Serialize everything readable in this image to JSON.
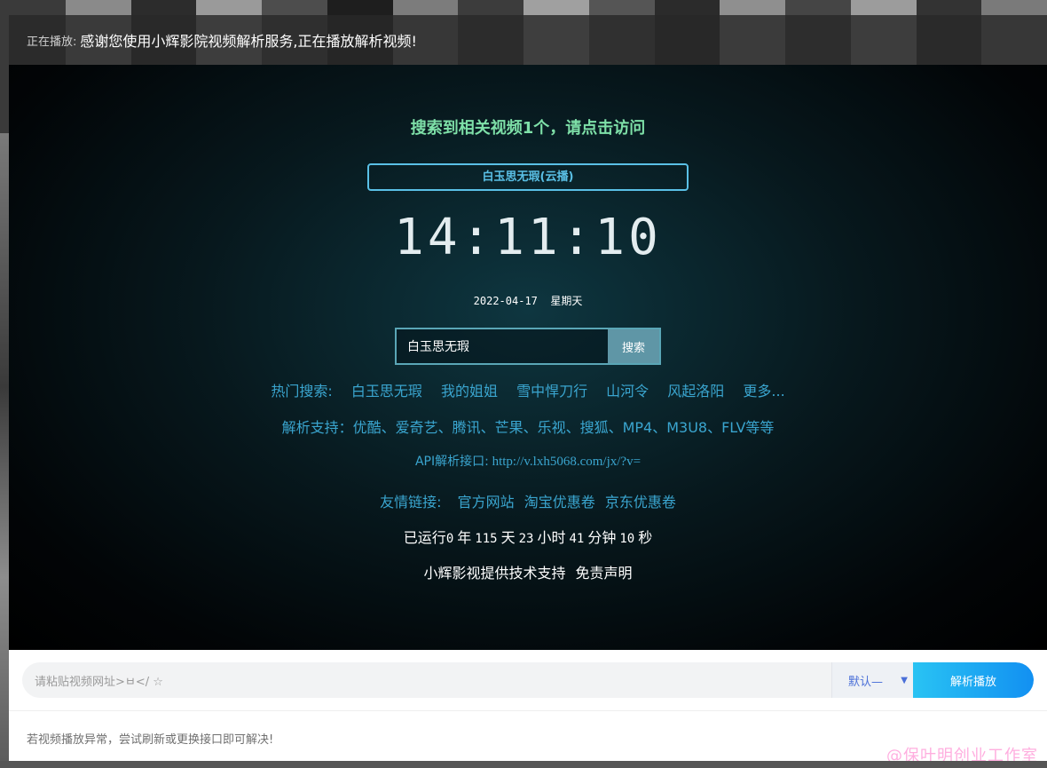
{
  "now_playing": {
    "label": "正在播放:",
    "text": "感谢您使用小辉影院视频解析服务,正在播放解析视频!"
  },
  "player": {
    "found_text": "搜索到相关视频1个，请点击访问",
    "result_button": "白玉思无瑕(云播)",
    "clock": "14:11:10",
    "date": "2022-04-17",
    "weekday": "星期天",
    "search": {
      "value": "白玉思无瑕",
      "button": "搜索"
    },
    "hot": {
      "label": "热门搜索:",
      "items": [
        "白玉思无瑕",
        "我的姐姐",
        "雪中悍刀行",
        "山河令",
        "风起洛阳",
        "更多..."
      ]
    },
    "support_text": "解析支持：优酷、爱奇艺、腾讯、芒果、乐视、搜狐、MP4、M3U8、FLV等等",
    "api": {
      "label": "API解析接口:",
      "url": "http://v.lxh5068.com/jx/?v="
    },
    "links": {
      "label": "友情链接:",
      "items": [
        "官方网站",
        "淘宝优惠卷",
        "京东优惠卷"
      ]
    },
    "uptime": {
      "prefix": "已运行",
      "years": "0",
      "years_unit": "年",
      "days": "115",
      "days_unit": "天",
      "hours": "23",
      "hours_unit": "小时",
      "minutes": "41",
      "minutes_unit": "分钟",
      "seconds": "10",
      "seconds_unit": "秒"
    },
    "credit": {
      "support": "小辉影视提供技术支持",
      "disclaimer": "免责声明"
    }
  },
  "panel": {
    "url_placeholder": "请粘贴视频网址>ㅂ</ ☆",
    "interface_select": "默认—",
    "parse_button": "解析播放",
    "tip": "若视频播放异常，尝试刷新或更换接口即可解决!"
  },
  "watermark": "@保叶明创业工作室",
  "colors": {
    "accent_green": "#7ee0a8",
    "link_blue": "#3aa5cf",
    "button_gradient": [
      "#29c3f3",
      "#1290f2"
    ]
  }
}
